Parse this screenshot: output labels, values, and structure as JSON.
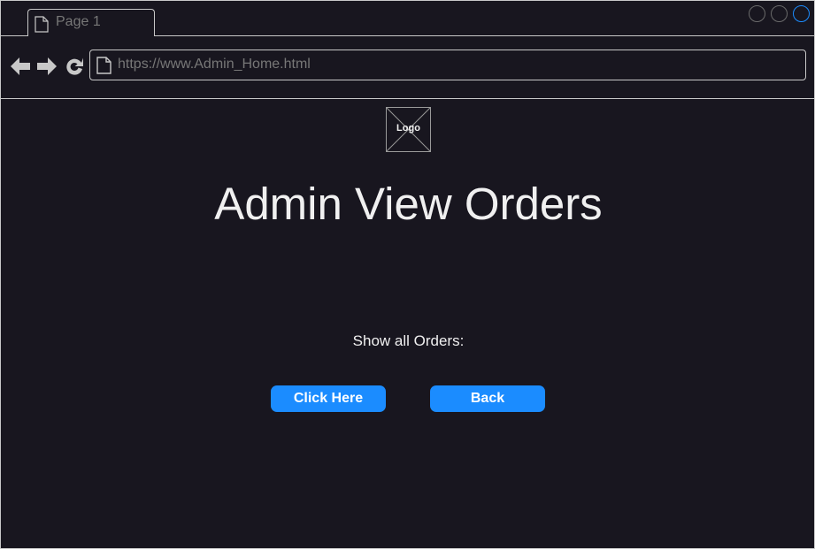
{
  "tab": {
    "label": "Page 1"
  },
  "address_bar": {
    "url": "https://www.Admin_Home.html"
  },
  "logo": {
    "label": "Logo"
  },
  "page": {
    "title": "Admin View Orders",
    "show_label": "Show all Orders:"
  },
  "buttons": {
    "click_here": "Click Here",
    "back": "Back"
  },
  "colors": {
    "background": "#18161f",
    "accent": "#1b8cff",
    "text": "#f0f0f0"
  }
}
